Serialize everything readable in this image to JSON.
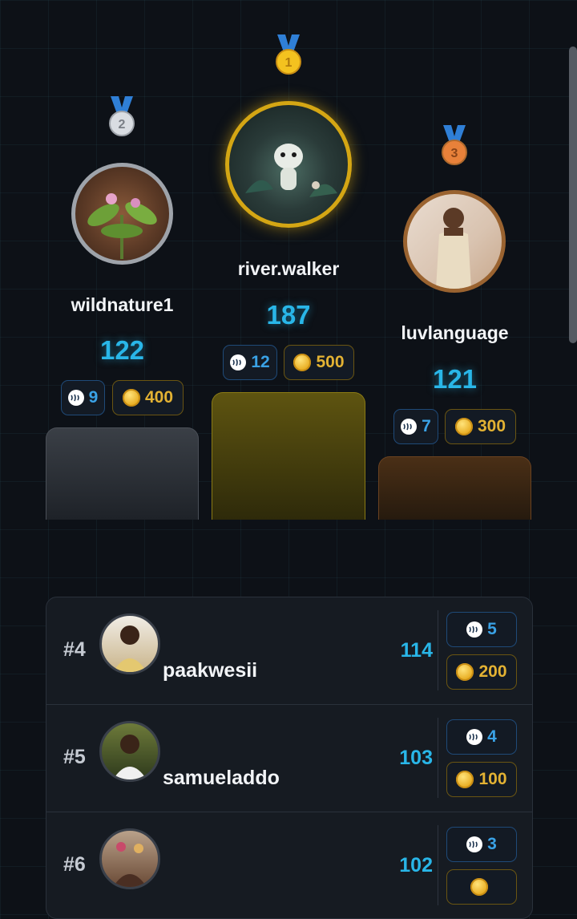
{
  "podium": {
    "first": {
      "rank_label": "1",
      "username": "river.walker",
      "score": "187",
      "steem": "12",
      "coins": "500"
    },
    "second": {
      "rank_label": "2",
      "username": "wildnature1",
      "score": "122",
      "steem": "9",
      "coins": "400"
    },
    "third": {
      "rank_label": "3",
      "username": "luvlanguage",
      "score": "121",
      "steem": "7",
      "coins": "300"
    }
  },
  "leaderboard": {
    "rows": [
      {
        "rank": "#4",
        "username": "paakwesii",
        "score": "114",
        "steem": "5",
        "coins": "200"
      },
      {
        "rank": "#5",
        "username": "samueladdo",
        "score": "103",
        "steem": "4",
        "coins": "100"
      },
      {
        "rank": "#6",
        "username": "",
        "score": "102",
        "steem": "3",
        "coins": ""
      }
    ]
  },
  "colors": {
    "gold": "#d4a614",
    "silver": "#9ea3aa",
    "bronze": "#b06a2c",
    "score_blue": "#29b6e8",
    "steem_blue": "#3aa2e6",
    "coin_gold": "#e3b233"
  },
  "icons": {
    "medal_first": "gold-medal-icon",
    "medal_second": "silver-medal-icon",
    "medal_third": "bronze-medal-icon",
    "steem": "steem-icon",
    "coin": "coin-icon"
  }
}
